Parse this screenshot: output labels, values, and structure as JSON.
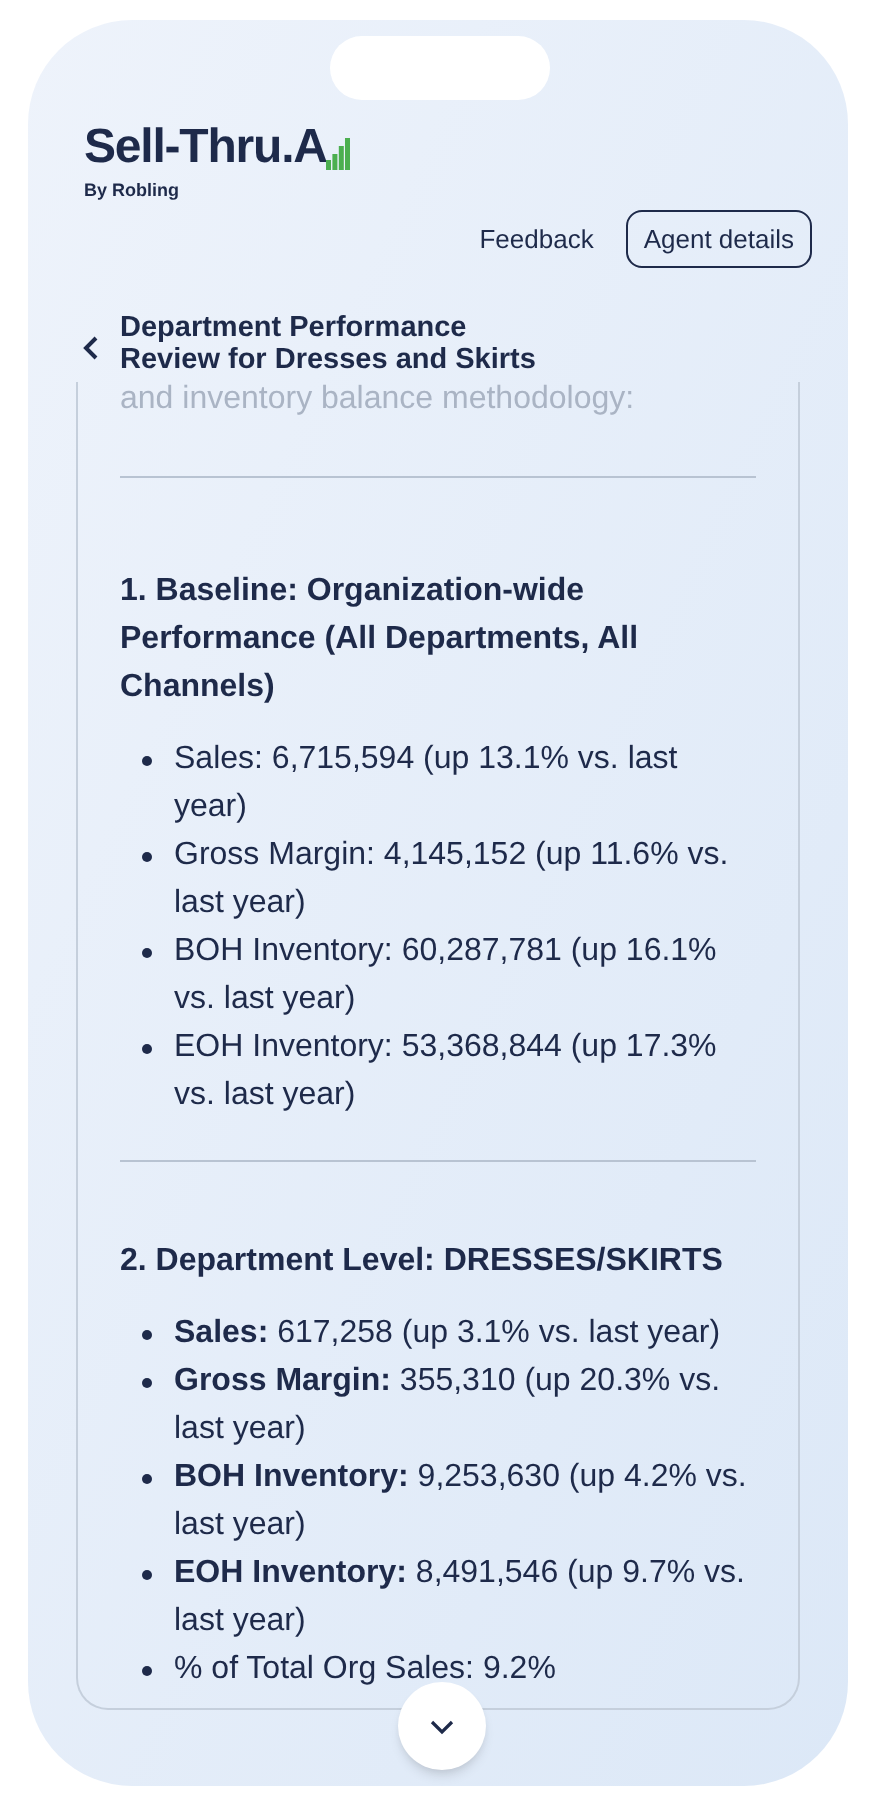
{
  "brand": {
    "name": "Sell-Thru.A",
    "tagline": "By Robling"
  },
  "header_links": [
    {
      "label": "Feedback",
      "kind": "link"
    },
    {
      "label": "Agent details",
      "kind": "outlined"
    }
  ],
  "page_title": "Department Performance Review for Dresses and Skirts",
  "faded_text": "and inventory balance methodology:",
  "sections": [
    {
      "heading": "1. Baseline: Organization-wide Performance (All Departments, All Channels)",
      "items": [
        "Sales: 6,715,594 (up 13.1% vs. last year)",
        "Gross Margin: 4,145,152 (up 11.6% vs. last year)",
        "BOH Inventory: 60,287,781 (up 16.1% vs. last year)",
        "EOH Inventory: 53,368,844 (up 17.3% vs. last year)"
      ]
    },
    {
      "heading": "2. Department Level: DRESSES/SKIRTS",
      "items": [
        "**Sales:** 617,258 (up 3.1% vs. last year)",
        "**Gross Margin:** 355,310 (up 20.3% vs. last year)",
        "**BOH Inventory:** 9,253,630 (up 4.2% vs. last year)",
        "**EOH Inventory:** 8,491,546 (up 9.7% vs. last year)",
        "% of Total Org Sales: 9.2%"
      ]
    }
  ]
}
